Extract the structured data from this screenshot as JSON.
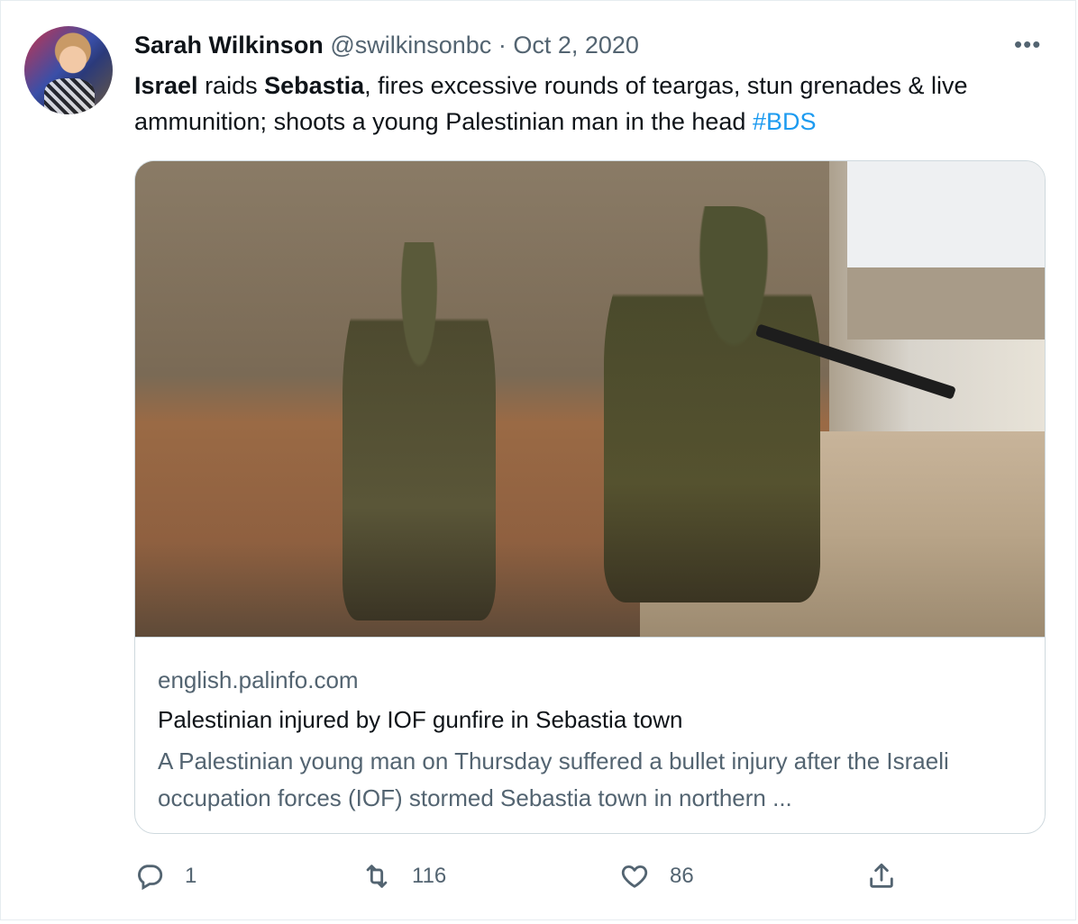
{
  "author": {
    "name": "Sarah Wilkinson",
    "handle": "@swilkinsonbc",
    "separator": "·",
    "date": "Oct 2, 2020"
  },
  "more_label": "•••",
  "tweet": {
    "bold1": "Israel",
    "text1": " raids ",
    "bold2": "Sebastia",
    "text2": ", fires excessive rounds of teargas, stun grenades & live ammunition; shoots a young Palestinian man in the head ",
    "hashtag": "#BDS"
  },
  "card": {
    "domain": "english.palinfo.com",
    "title": "Palestinian injured by IOF gunfire in Sebastia town",
    "description": "A Palestinian young man on Thursday suffered a bullet injury after the Israeli occupation forces (IOF) stormed Sebastia town in northern ..."
  },
  "actions": {
    "reply": {
      "icon": "reply-icon",
      "count": "1"
    },
    "retweet": {
      "icon": "retweet-icon",
      "count": "116"
    },
    "like": {
      "icon": "heart-icon",
      "count": "86"
    },
    "share": {
      "icon": "share-icon"
    }
  }
}
